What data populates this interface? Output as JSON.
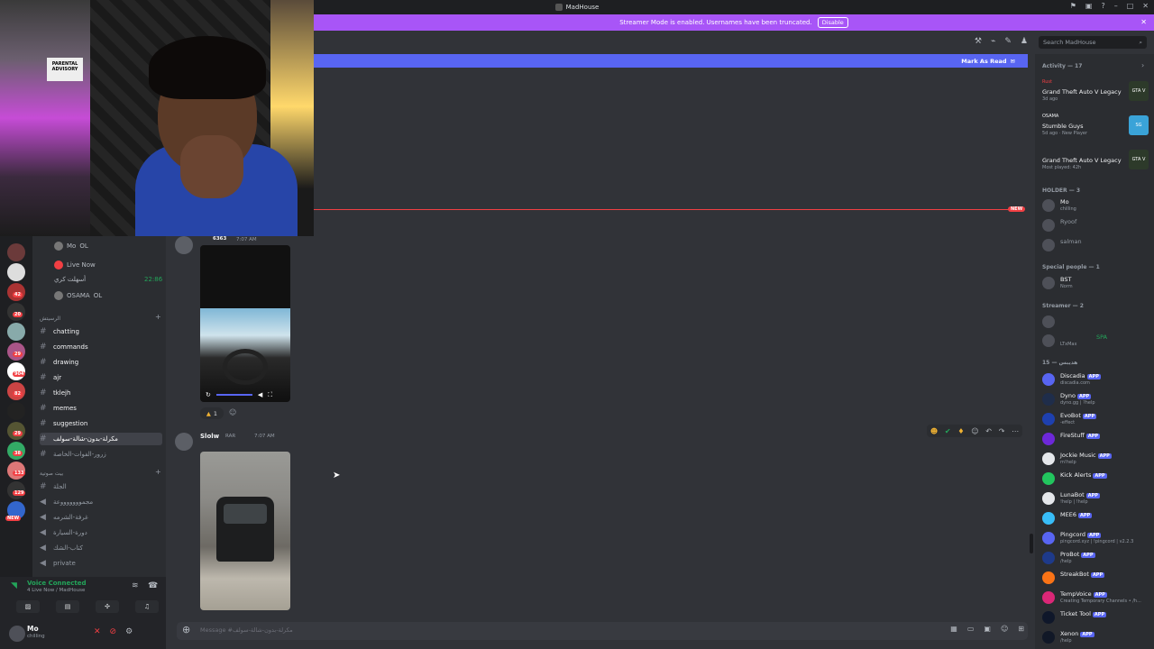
{
  "titlebar": {
    "title": "MadHouse"
  },
  "banner": {
    "text": "Streamer Mode is enabled. Usernames have been truncated.",
    "disable_label": "Disable"
  },
  "search": {
    "placeholder": "Search MadHouse"
  },
  "new_messages": {
    "mark_read_label": "Mark As Read",
    "new_tag": "NEW"
  },
  "webcam": {
    "poster_text": "PARENTAL ADVISORY"
  },
  "servers": {
    "badges": [
      "42",
      "20",
      "29",
      "904",
      "82",
      "29",
      "38",
      "133",
      "129",
      "NEW"
    ]
  },
  "voice_channel": {
    "users": [
      {
        "name": "Mo",
        "tag": "OL"
      },
      {
        "name": "Live Now",
        "sub": ""
      },
      {
        "name": "أسهلت كري",
        "time": "22:86"
      },
      {
        "name": "OSAMA",
        "tag": "OL"
      }
    ]
  },
  "channels": {
    "category_1": "الرسيتش",
    "items": [
      {
        "name": "chatting"
      },
      {
        "name": "commands"
      },
      {
        "name": "drawing"
      },
      {
        "name": "ajr"
      },
      {
        "name": "tklejh"
      },
      {
        "name": "memes"
      },
      {
        "name": "suggestion"
      },
      {
        "name": "مكرلة-بدون-شالة-سولف"
      },
      {
        "name": "زرور-الفوات-الخاصة"
      }
    ],
    "category_2": "بيت صوتية",
    "voice_items": [
      {
        "name": "الجلة"
      },
      {
        "name": "مجموووووووعة"
      },
      {
        "name": "غرفة-الشرمه"
      },
      {
        "name": "دورة-السيارة"
      },
      {
        "name": "كتاب-الشك"
      },
      {
        "name": "private"
      }
    ]
  },
  "voice_panel": {
    "status": "Voice Connected",
    "sub": "4 Live Now / MadHouse"
  },
  "user_panel": {
    "name": "Mo",
    "status": "chilling"
  },
  "messages": {
    "msg1": {
      "author": "6363",
      "time": "7:07 AM",
      "reaction_count": "1"
    },
    "msg2": {
      "author": "Slolw",
      "tag": "RAR",
      "time": "7:07 AM"
    }
  },
  "input": {
    "placeholder": "Message #مكرلة-بدون-شالة-سولف"
  },
  "member_list": {
    "activity_header": "Activity — 17",
    "activities": [
      {
        "label": "Rust",
        "title": "Grand Theft Auto V Legacy",
        "sub": "3d ago",
        "art": "GTA V"
      },
      {
        "label": "OSAMA",
        "title": "Stumble Guys",
        "sub": "5d ago · New Player",
        "art": "SG"
      },
      {
        "label": "",
        "title": "Grand Theft Auto V Legacy",
        "sub": "Most played: 42h",
        "art": "GTA V"
      }
    ],
    "holder_header": "HOLDER — 3",
    "holder": [
      {
        "name": "Mo",
        "sub": "chilling"
      },
      {
        "name": "Ryoof",
        "sub": ""
      },
      {
        "name": "salman",
        "sub": ""
      }
    ],
    "special_header": "Special people — 1",
    "special": [
      {
        "name": "BST",
        "sub": "Norm"
      }
    ],
    "streamer_header": "Streamer — 2",
    "streamer": [
      {
        "name": "",
        "sub": ""
      },
      {
        "name": "SPA",
        "sub": "LTxMax"
      }
    ],
    "bots_header": "15 — هديبس",
    "bots": [
      {
        "name": "Discadia",
        "sub": "discadia.com"
      },
      {
        "name": "Dyno",
        "sub": "dyno.gg | ?help"
      },
      {
        "name": "EvoBot",
        "sub": "-effect"
      },
      {
        "name": "FireStuff",
        "sub": ""
      },
      {
        "name": "Jockie Music",
        "sub": "m!help"
      },
      {
        "name": "Kick Alerts",
        "sub": ""
      },
      {
        "name": "LunaBot",
        "sub": "!help | !help"
      },
      {
        "name": "MEE6",
        "sub": ""
      },
      {
        "name": "Pingcord",
        "sub": "pingcord.xyz | !pingcord | v2.2.3"
      },
      {
        "name": "ProBot",
        "sub": "/help"
      },
      {
        "name": "StreakBot",
        "sub": ""
      },
      {
        "name": "TempVoice",
        "sub": "Creating Temporary Channels • /h..."
      },
      {
        "name": "Ticket Tool",
        "sub": ""
      },
      {
        "name": "Xenon",
        "sub": "/help"
      }
    ],
    "app_label": "APP"
  },
  "colors": {
    "accent": "#5865f2",
    "banner": "#a855f7",
    "danger": "#f23f43",
    "online": "#23a55a"
  }
}
